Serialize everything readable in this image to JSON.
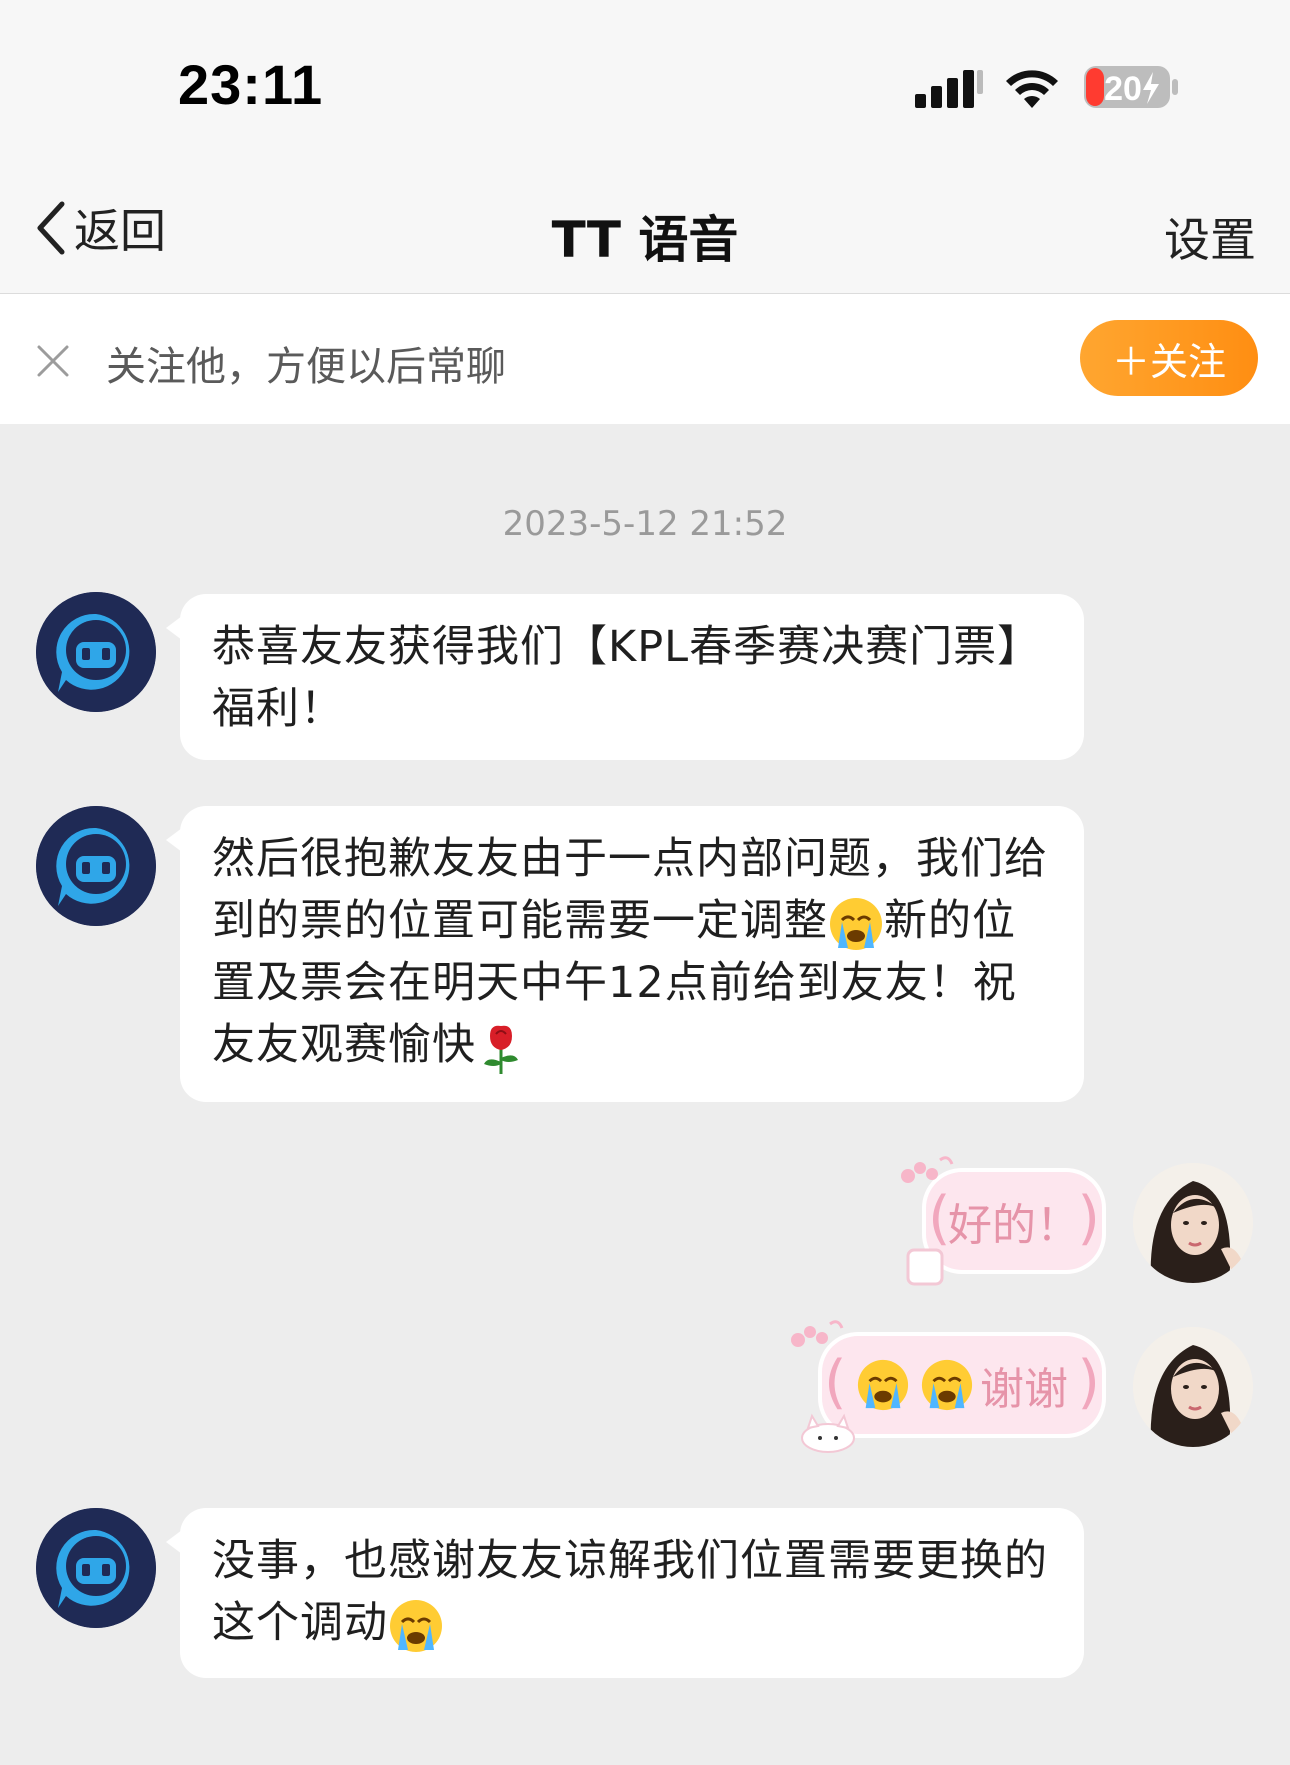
{
  "status_bar": {
    "time": "23:11",
    "battery_level": "20"
  },
  "nav": {
    "back_label": "返回",
    "title": "TT 语音",
    "settings_label": "设置"
  },
  "follow_bar": {
    "hint": "关注他，方便以后常聊",
    "follow_button": "＋关注"
  },
  "chat": {
    "timestamp": "2023-5-12 21:52",
    "messages": [
      {
        "sender": "bot",
        "text": "恭喜友友获得我们【KPL春季赛决赛门票】福利！"
      },
      {
        "sender": "bot",
        "text": "然后很抱歉友友由于一点内部问题，我们给到的票的位置可能需要一定调整",
        "text2": "新的位置及票会在明天中午12点前给到友友！祝友友观赛愉快",
        "emoji1": "crying-face",
        "emoji2": "rose"
      },
      {
        "sender": "user",
        "text": "好的！"
      },
      {
        "sender": "user",
        "text": "谢谢",
        "emoji": "crying-face"
      },
      {
        "sender": "bot",
        "text": "没事，也感谢友友谅解我们位置需要更换的这个调动",
        "emoji": "crying-face"
      }
    ]
  },
  "colors": {
    "follow_button": "#ff9b22",
    "background": "#ededed",
    "bubble": "#ffffff",
    "cute_bubble": "#fde6ee"
  }
}
